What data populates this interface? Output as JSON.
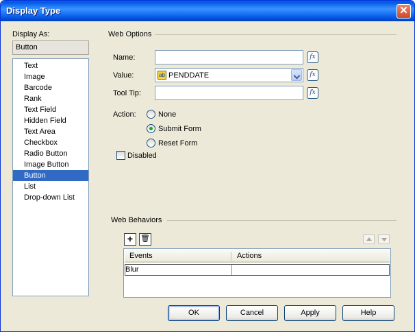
{
  "window": {
    "title": "Display Type",
    "close_glyph": "✕"
  },
  "display_as": {
    "label": "Display As:",
    "value": "Button",
    "items": [
      "Text",
      "Image",
      "Barcode",
      "Rank",
      "Text Field",
      "Hidden Field",
      "Text Area",
      "Checkbox",
      "Radio Button",
      "Image Button",
      "Button",
      "List",
      "Drop-down List"
    ],
    "selected": "Button"
  },
  "web_options": {
    "title": "Web Options",
    "name_label": "Name:",
    "name_value": "",
    "value_label": "Value:",
    "value_value": "PENDDATE",
    "value_icon": "field-icon",
    "tooltip_label": "Tool Tip:",
    "tooltip_value": "",
    "fx_label": "fx",
    "action_label": "Action:",
    "actions": [
      "None",
      "Submit Form",
      "Reset Form"
    ],
    "action_selected": "Submit Form",
    "disabled_label": "Disabled",
    "disabled_checked": false
  },
  "web_behaviors": {
    "title": "Web Behaviors",
    "add_glyph": "+",
    "delete_glyph": "🗑",
    "columns": [
      "Events",
      "Actions"
    ],
    "rows": [
      {
        "event": "Blur",
        "action": ""
      }
    ]
  },
  "buttons": {
    "ok": "OK",
    "cancel": "Cancel",
    "apply": "Apply",
    "help": "Help"
  },
  "colors": {
    "accent": "#316ac5",
    "titlebar": "#0058e6",
    "face": "#ece9d8"
  }
}
